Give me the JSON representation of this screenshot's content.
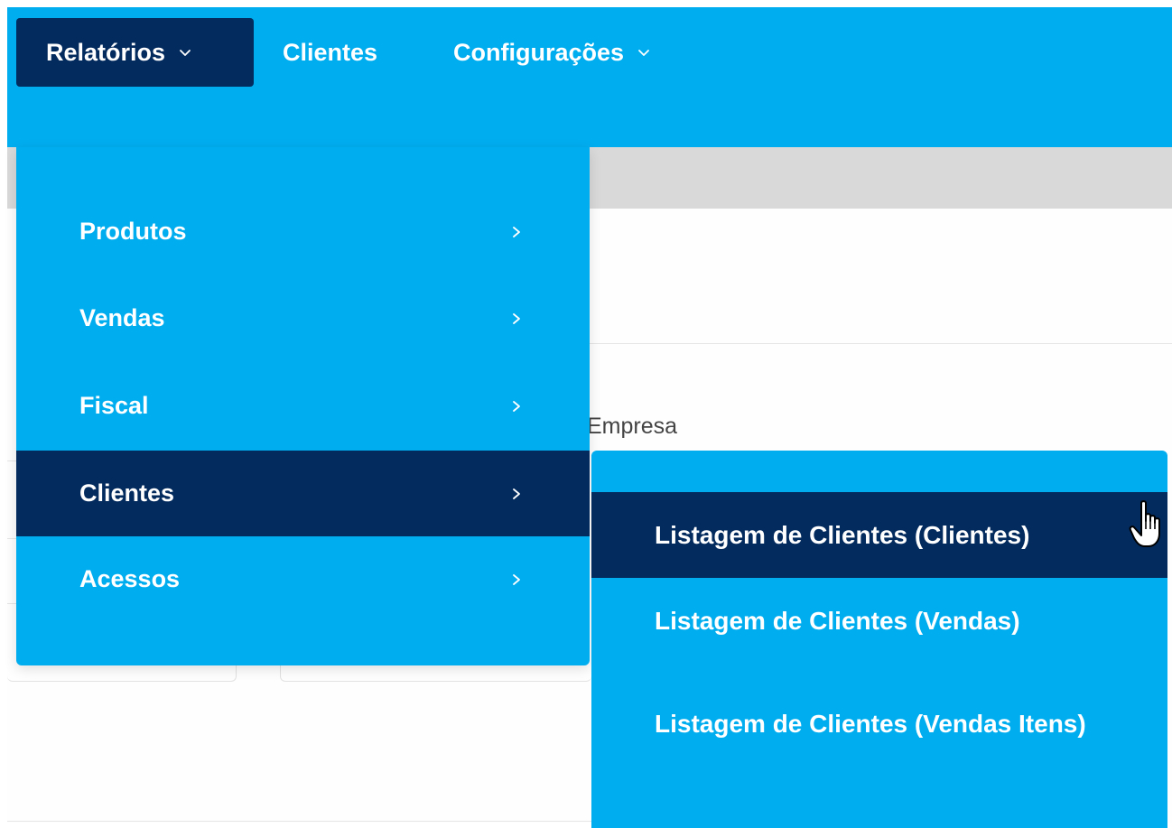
{
  "navbar": {
    "items": [
      {
        "label": "Relatórios",
        "has_dropdown": true,
        "active": true
      },
      {
        "label": "Clientes",
        "has_dropdown": false,
        "active": false
      },
      {
        "label": "Configurações",
        "has_dropdown": true,
        "active": false
      }
    ]
  },
  "background": {
    "label": "Empresa"
  },
  "dropdown": {
    "items": [
      {
        "label": "Produtos",
        "active": false
      },
      {
        "label": "Vendas",
        "active": false
      },
      {
        "label": "Fiscal",
        "active": false
      },
      {
        "label": "Clientes",
        "active": true
      },
      {
        "label": "Acessos",
        "active": false
      }
    ]
  },
  "submenu": {
    "items": [
      {
        "label": "Listagem de Clientes (Clientes)",
        "active": true
      },
      {
        "label": "Listagem de Clientes (Vendas)",
        "active": false
      },
      {
        "label": "Listagem de Clientes (Vendas Itens)",
        "active": false
      }
    ]
  },
  "colors": {
    "accent": "#00adef",
    "active": "#042b5e",
    "text_on_accent": "#ffffff",
    "background_band": "#d9d9d9"
  },
  "icons": [
    "chevron-down-icon",
    "chevron-right-icon",
    "hand-pointer-cursor-icon"
  ]
}
